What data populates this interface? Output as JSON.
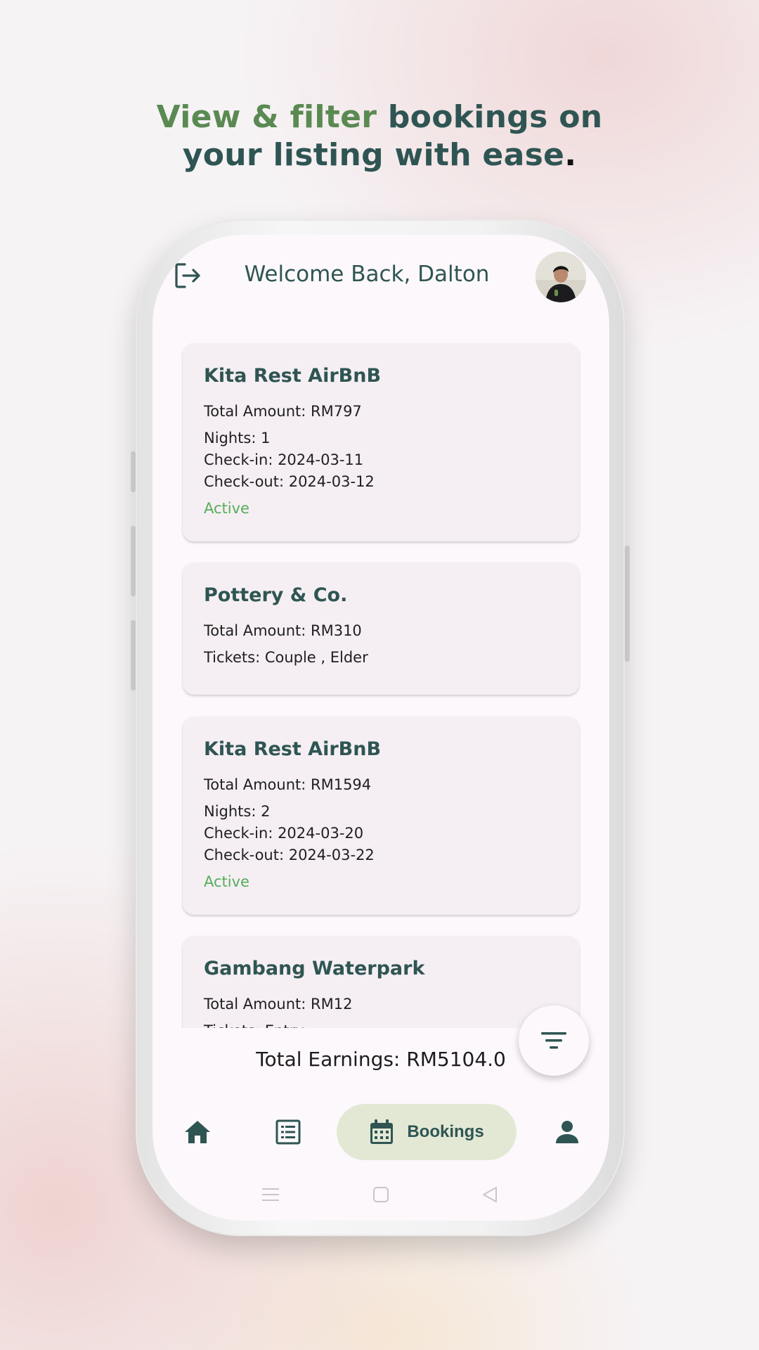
{
  "headline": {
    "highlight": "View & filter",
    "rest_line1": " bookings on",
    "line2": "your listing with ease",
    "end": "."
  },
  "header": {
    "welcome": "Welcome Back, Dalton",
    "logout_icon": "logout-icon",
    "avatar": "user-avatar"
  },
  "bookings": [
    {
      "title": "Kita Rest AirBnB",
      "total": "Total Amount: RM797",
      "nights": "Nights: 1",
      "checkin": "Check-in: 2024-03-11",
      "checkout": "Check-out: 2024-03-12",
      "status": "Active"
    },
    {
      "title": "Pottery & Co.",
      "total": "Total Amount: RM310",
      "tickets": "Tickets: Couple , Elder"
    },
    {
      "title": "Kita Rest AirBnB",
      "total": "Total Amount: RM1594",
      "nights": "Nights: 2",
      "checkin": "Check-in: 2024-03-20",
      "checkout": "Check-out: 2024-03-22",
      "status": "Active"
    },
    {
      "title": "Gambang Waterpark",
      "total": "Total Amount: RM12",
      "tickets": "Tickets: Entry"
    }
  ],
  "earnings": "Total Earnings: RM5104.0",
  "filter_icon": "filter-icon",
  "nav": {
    "items": [
      {
        "icon": "home-icon"
      },
      {
        "icon": "list-icon"
      },
      {
        "icon": "calendar-icon",
        "label": "Bookings",
        "active": true
      },
      {
        "icon": "person-icon"
      }
    ]
  },
  "system_nav": [
    "menu-icon",
    "home-square-icon",
    "back-icon"
  ],
  "colors": {
    "brand_dark": "#2f5553",
    "brand_green": "#5a8a52",
    "status_active": "#56ad5b",
    "nav_active_bg": "#e3e8d5",
    "card_bg": "#f5eff3"
  }
}
